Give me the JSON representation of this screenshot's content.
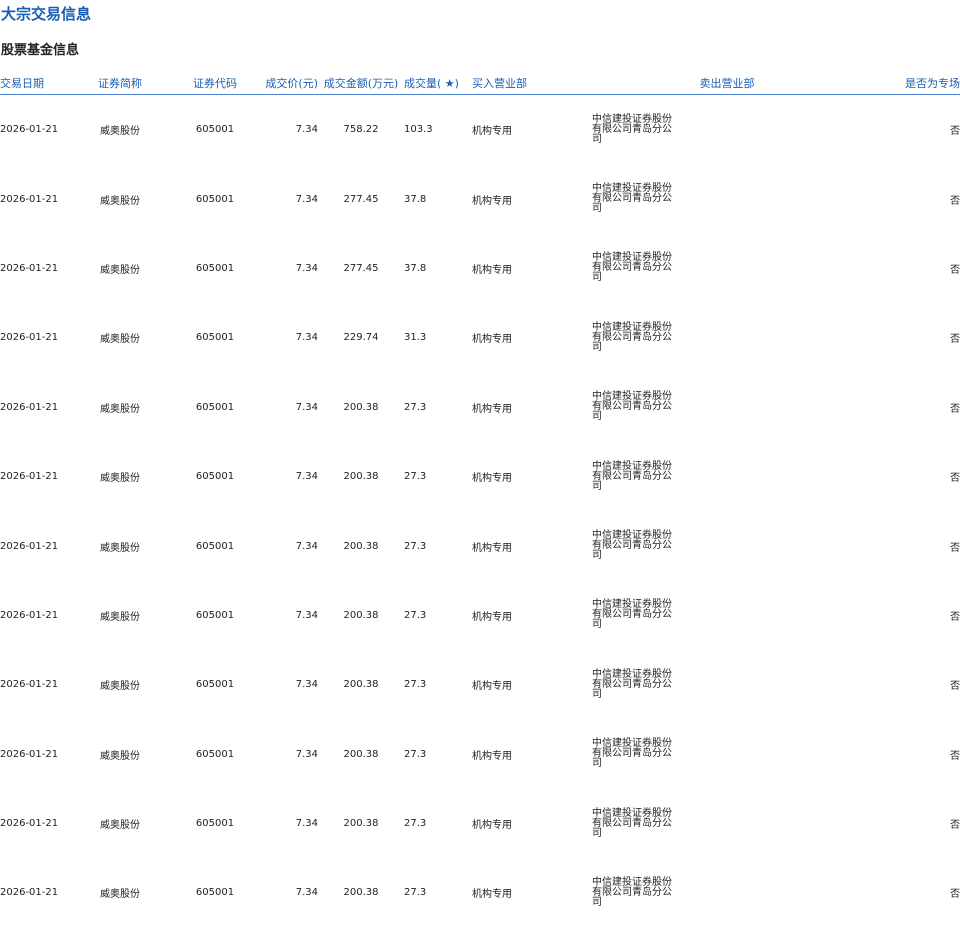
{
  "page": {
    "title": "大宗交易信息",
    "section_title": "股票基金信息"
  },
  "table": {
    "columns": [
      "交易日期",
      "证券简称",
      "证券代码",
      "成交价(元)",
      "成交金额(万元)",
      "成交量( ★)",
      "买入营业部",
      "卖出营业部",
      "是否为专场"
    ],
    "rows": [
      {
        "date": "2026-01-21",
        "name": "威奥股份",
        "code": "605001",
        "price": "7.34",
        "amount": "758.22",
        "volume": "103.3",
        "buyer": "机构专用",
        "seller": "中信建投证券股份有限公司青岛分公司",
        "special": "否"
      },
      {
        "date": "2026-01-21",
        "name": "威奥股份",
        "code": "605001",
        "price": "7.34",
        "amount": "277.45",
        "volume": "37.8",
        "buyer": "机构专用",
        "seller": "中信建投证券股份有限公司青岛分公司",
        "special": "否"
      },
      {
        "date": "2026-01-21",
        "name": "威奥股份",
        "code": "605001",
        "price": "7.34",
        "amount": "277.45",
        "volume": "37.8",
        "buyer": "机构专用",
        "seller": "中信建投证券股份有限公司青岛分公司",
        "special": "否"
      },
      {
        "date": "2026-01-21",
        "name": "威奥股份",
        "code": "605001",
        "price": "7.34",
        "amount": "229.74",
        "volume": "31.3",
        "buyer": "机构专用",
        "seller": "中信建投证券股份有限公司青岛分公司",
        "special": "否"
      },
      {
        "date": "2026-01-21",
        "name": "威奥股份",
        "code": "605001",
        "price": "7.34",
        "amount": "200.38",
        "volume": "27.3",
        "buyer": "机构专用",
        "seller": "中信建投证券股份有限公司青岛分公司",
        "special": "否"
      },
      {
        "date": "2026-01-21",
        "name": "威奥股份",
        "code": "605001",
        "price": "7.34",
        "amount": "200.38",
        "volume": "27.3",
        "buyer": "机构专用",
        "seller": "中信建投证券股份有限公司青岛分公司",
        "special": "否"
      },
      {
        "date": "2026-01-21",
        "name": "威奥股份",
        "code": "605001",
        "price": "7.34",
        "amount": "200.38",
        "volume": "27.3",
        "buyer": "机构专用",
        "seller": "中信建投证券股份有限公司青岛分公司",
        "special": "否"
      },
      {
        "date": "2026-01-21",
        "name": "威奥股份",
        "code": "605001",
        "price": "7.34",
        "amount": "200.38",
        "volume": "27.3",
        "buyer": "机构专用",
        "seller": "中信建投证券股份有限公司青岛分公司",
        "special": "否"
      },
      {
        "date": "2026-01-21",
        "name": "威奥股份",
        "code": "605001",
        "price": "7.34",
        "amount": "200.38",
        "volume": "27.3",
        "buyer": "机构专用",
        "seller": "中信建投证券股份有限公司青岛分公司",
        "special": "否"
      },
      {
        "date": "2026-01-21",
        "name": "威奥股份",
        "code": "605001",
        "price": "7.34",
        "amount": "200.38",
        "volume": "27.3",
        "buyer": "机构专用",
        "seller": "中信建投证券股份有限公司青岛分公司",
        "special": "否"
      },
      {
        "date": "2026-01-21",
        "name": "威奥股份",
        "code": "605001",
        "price": "7.34",
        "amount": "200.38",
        "volume": "27.3",
        "buyer": "机构专用",
        "seller": "中信建投证券股份有限公司青岛分公司",
        "special": "否"
      },
      {
        "date": "2026-01-21",
        "name": "威奥股份",
        "code": "605001",
        "price": "7.34",
        "amount": "200.38",
        "volume": "27.3",
        "buyer": "机构专用",
        "seller": "中信建投证券股份有限公司青岛分公司",
        "special": "否"
      }
    ]
  },
  "colors": {
    "accent": "#1a5fb4",
    "header_rule": "#4a7fd0",
    "text": "#222222"
  }
}
